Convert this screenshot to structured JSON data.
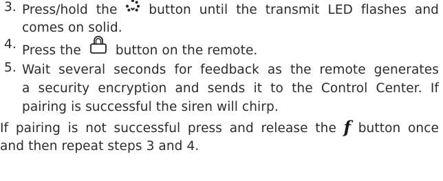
{
  "steps": [
    {
      "number": "3.",
      "line1_before_icon": "Press/hold the",
      "icon": "dotted-rotate-icon",
      "line1_after_icon": "button until the transmit LED flashes and",
      "line2": "comes on solid."
    },
    {
      "number": "4.",
      "text_before_icon": "Press the",
      "icon": "padlock-icon",
      "text_after_icon": "button on the remote."
    },
    {
      "number": "5.",
      "line1": "Wait several seconds for feedback as the remote generates",
      "line2": "a security encryption and sends it to the Control Center. If",
      "line3": "pairing is successful the siren will chirp."
    }
  ],
  "note": {
    "line1_before_glyph": "If pairing is not successful press and release the",
    "glyph": "f",
    "line1_after_glyph": "button once",
    "line2": "and then repeat steps 3 and 4."
  }
}
